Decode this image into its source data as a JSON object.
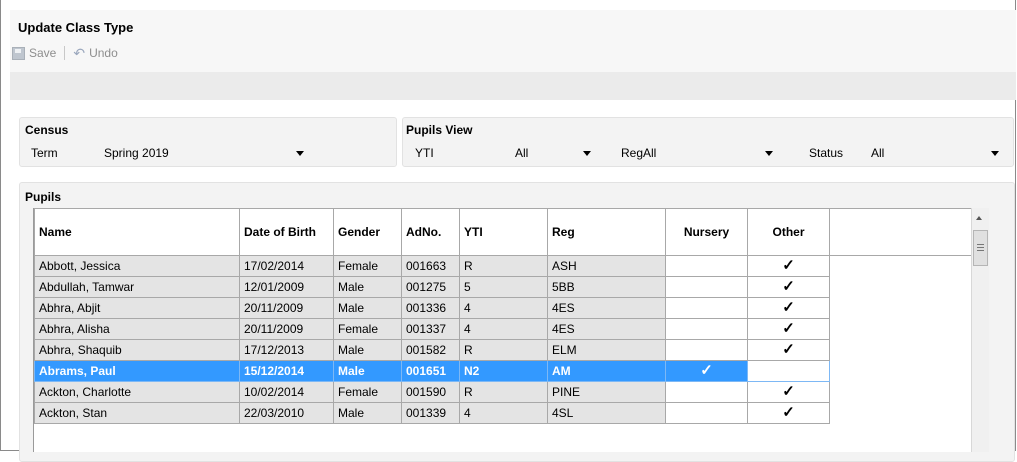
{
  "window": {
    "title": "Update Class Type"
  },
  "toolbar": {
    "save_label": "Save",
    "undo_label": "Undo"
  },
  "census": {
    "title": "Census",
    "term_label": "Term",
    "term_value": "Spring 2019"
  },
  "pupils_view": {
    "title": "Pupils View",
    "yti_label": "YTI",
    "yti_value": "All",
    "reg_label": "Reg",
    "reg_value": "All",
    "status_label": "Status",
    "status_value": "All"
  },
  "pupils": {
    "title": "Pupils",
    "columns": [
      "Name",
      "Date of Birth",
      "Gender",
      "AdNo.",
      "YTI",
      "Reg",
      "Nursery",
      "Other"
    ],
    "rows": [
      {
        "name": "Abbott, Jessica",
        "dob": "17/02/2014",
        "gender": "Female",
        "adno": "001663",
        "yti": "R",
        "reg": "ASH",
        "nursery": "",
        "other": "✓"
      },
      {
        "name": "Abdullah, Tamwar",
        "dob": "12/01/2009",
        "gender": "Male",
        "adno": "001275",
        "yti": "5",
        "reg": "5BB",
        "nursery": "",
        "other": "✓"
      },
      {
        "name": "Abhra, Abjit",
        "dob": "20/11/2009",
        "gender": "Male",
        "adno": "001336",
        "yti": "4",
        "reg": "4ES",
        "nursery": "",
        "other": "✓"
      },
      {
        "name": "Abhra, Alisha",
        "dob": "20/11/2009",
        "gender": "Female",
        "adno": "001337",
        "yti": "4",
        "reg": "4ES",
        "nursery": "",
        "other": "✓"
      },
      {
        "name": "Abhra, Shaquib",
        "dob": "17/12/2013",
        "gender": "Male",
        "adno": "001582",
        "yti": "R",
        "reg": "ELM",
        "nursery": "",
        "other": "✓"
      },
      {
        "name": "Abrams, Paul",
        "dob": "15/12/2014",
        "gender": "Male",
        "adno": "001651",
        "yti": "N2",
        "reg": "AM",
        "nursery": "✓",
        "other": ""
      },
      {
        "name": "Ackton, Charlotte",
        "dob": "10/02/2014",
        "gender": "Female",
        "adno": "001590",
        "yti": "R",
        "reg": "PINE",
        "nursery": "",
        "other": "✓"
      },
      {
        "name": "Ackton, Stan",
        "dob": "22/03/2010",
        "gender": "Male",
        "adno": "001339",
        "yti": "4",
        "reg": "4SL",
        "nursery": "",
        "other": "✓"
      }
    ]
  },
  "colors": {
    "selection": "#3399ff",
    "readonly_cell": "#e4e4e4"
  }
}
